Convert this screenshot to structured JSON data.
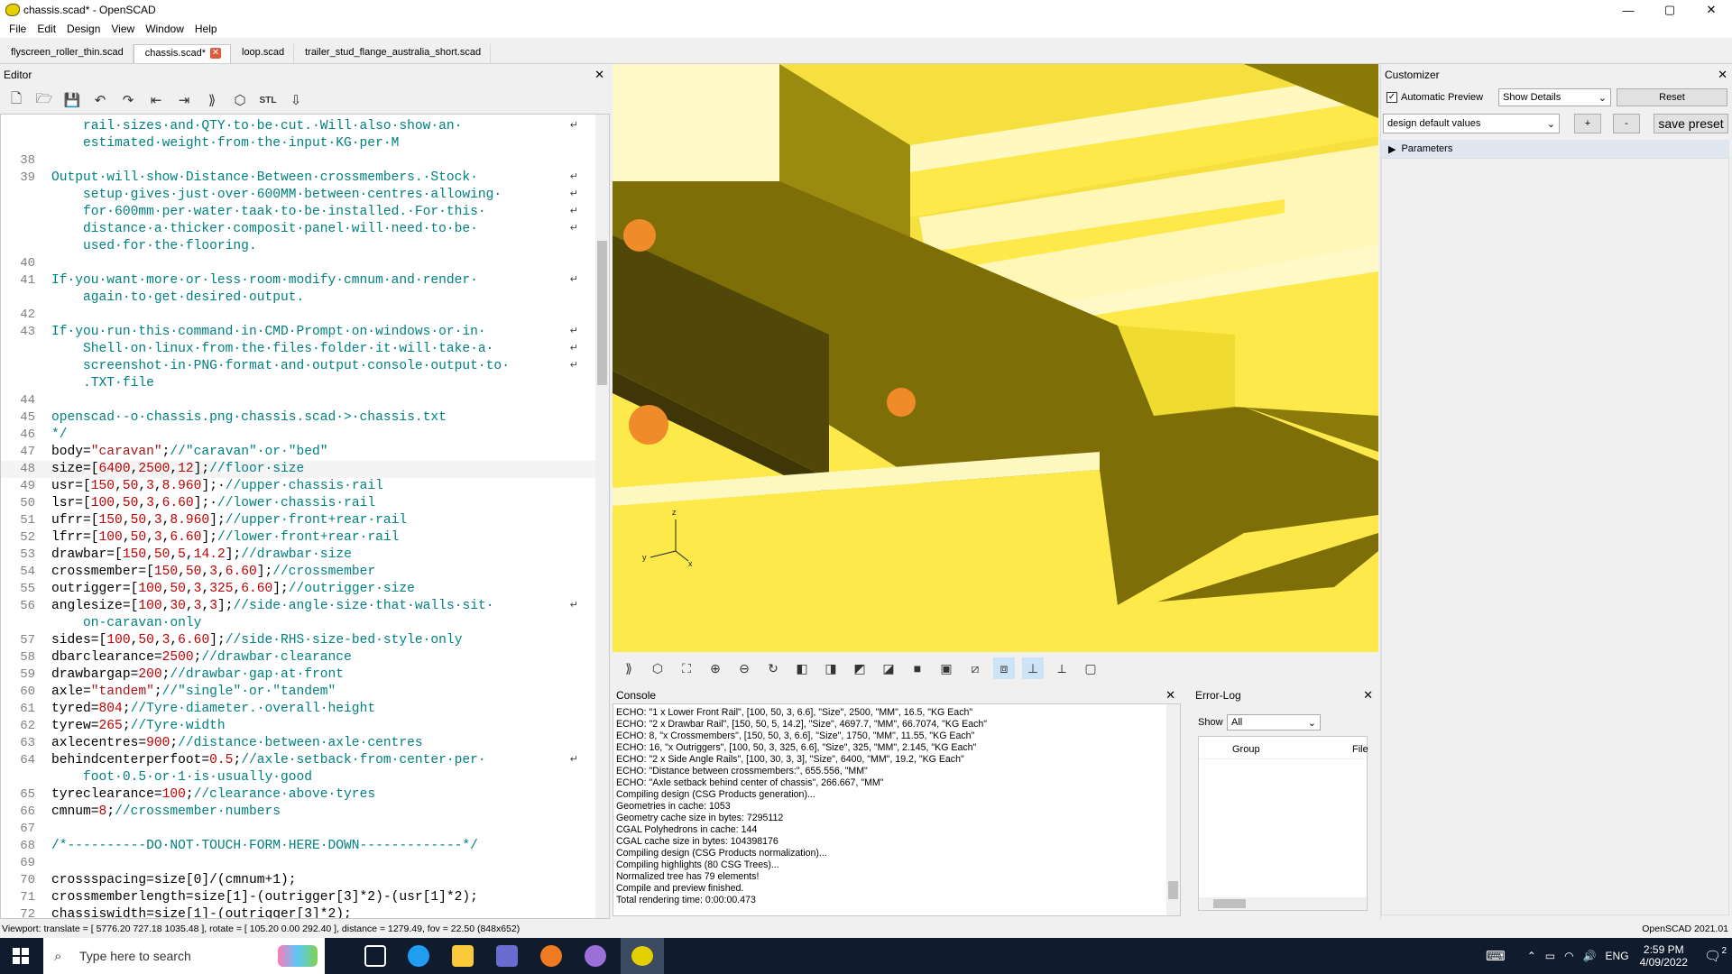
{
  "window": {
    "title": "chassis.scad* - OpenSCAD",
    "minimize": "—",
    "maximize": "▢",
    "close": "✕"
  },
  "menu": [
    "File",
    "Edit",
    "Design",
    "View",
    "Window",
    "Help"
  ],
  "tabs": [
    {
      "label": "flyscreen_roller_thin.scad"
    },
    {
      "label": "chassis.scad*"
    },
    {
      "label": "loop.scad"
    },
    {
      "label": "trailer_stud_flange_australia_short.scad"
    }
  ],
  "editor": {
    "title": "Editor",
    "close": "✕",
    "lines": [
      {
        "n": "",
        "t": "    rail·sizes·and·QTY·to·be·cut.·Will·also·show·an·",
        "c": "cm",
        "w": true
      },
      {
        "n": "",
        "t": "    estimated·weight·from·the·input·KG·per·M",
        "c": "cm",
        "w": false
      },
      {
        "n": "38",
        "t": "",
        "c": "cm",
        "w": false
      },
      {
        "n": "39",
        "t": "Output·will·show·Distance·Between·crossmembers.·Stock·",
        "c": "cm",
        "w": true
      },
      {
        "n": "",
        "t": "    setup·gives·just·over·600MM·between·centres·allowing·",
        "c": "cm",
        "w": true
      },
      {
        "n": "",
        "t": "    for·600mm·per·water·taak·to·be·installed.·For·this·",
        "c": "cm",
        "w": true
      },
      {
        "n": "",
        "t": "    distance·a·thicker·composit·panel·will·need·to·be·",
        "c": "cm",
        "w": true
      },
      {
        "n": "",
        "t": "    used·for·the·flooring.",
        "c": "cm",
        "w": false
      },
      {
        "n": "40",
        "t": "",
        "c": "cm",
        "w": false
      },
      {
        "n": "41",
        "t": "If·you·want·more·or·less·room·modify·cmnum·and·render·",
        "c": "cm",
        "w": true
      },
      {
        "n": "",
        "t": "    again·to·get·desired·output.",
        "c": "cm",
        "w": false
      },
      {
        "n": "42",
        "t": "",
        "c": "cm",
        "w": false
      },
      {
        "n": "43",
        "t": "If·you·run·this·command·in·CMD·Prompt·on·windows·or·in·",
        "c": "cm",
        "w": true
      },
      {
        "n": "",
        "t": "    Shell·on·linux·from·the·files·folder·it·will·take·a·",
        "c": "cm",
        "w": true
      },
      {
        "n": "",
        "t": "    screenshot·in·PNG·format·and·output·console·output·to·",
        "c": "cm",
        "w": true
      },
      {
        "n": "",
        "t": "    .TXT·file",
        "c": "cm",
        "w": false
      },
      {
        "n": "44",
        "t": "",
        "c": "cm",
        "w": false
      },
      {
        "n": "45",
        "t": "openscad·-o·chassis.png·chassis.scad·>·chassis.txt",
        "c": "cm",
        "w": false
      },
      {
        "n": "46",
        "t": "*/",
        "c": "cm",
        "w": false
      },
      {
        "n": "47",
        "t": "body=\"caravan\";//\"caravan\"·or·\"bed\"",
        "c": "mix",
        "w": false
      },
      {
        "n": "48",
        "t": "size=[6400,2500,12];//floor·size",
        "c": "mix",
        "w": false,
        "cur": true
      },
      {
        "n": "49",
        "t": "usr=[150,50,3,8.960];·//upper·chassis·rail",
        "c": "mix",
        "w": false
      },
      {
        "n": "50",
        "t": "lsr=[100,50,3,6.60];·//lower·chassis·rail",
        "c": "mix",
        "w": false
      },
      {
        "n": "51",
        "t": "ufrr=[150,50,3,8.960];//upper·front+rear·rail",
        "c": "mix",
        "w": false
      },
      {
        "n": "52",
        "t": "lfrr=[100,50,3,6.60];//lower·front+rear·rail",
        "c": "mix",
        "w": false
      },
      {
        "n": "53",
        "t": "drawbar=[150,50,5,14.2];//drawbar·size",
        "c": "mix",
        "w": false
      },
      {
        "n": "54",
        "t": "crossmember=[150,50,3,6.60];//crossmember",
        "c": "mix",
        "w": false
      },
      {
        "n": "55",
        "t": "outrigger=[100,50,3,325,6.60];//outrigger·size",
        "c": "mix",
        "w": false
      },
      {
        "n": "56",
        "t": "anglesize=[100,30,3,3];//side·angle·size·that·walls·sit·",
        "c": "mix",
        "w": true
      },
      {
        "n": "",
        "t": "    on-caravan·only",
        "c": "cm",
        "w": false
      },
      {
        "n": "57",
        "t": "sides=[100,50,3,6.60];//side·RHS·size-bed·style·only",
        "c": "mix",
        "w": false
      },
      {
        "n": "58",
        "t": "dbarclearance=2500;//drawbar·clearance",
        "c": "mix",
        "w": false
      },
      {
        "n": "59",
        "t": "drawbargap=200;//drawbar·gap·at·front",
        "c": "mix",
        "w": false
      },
      {
        "n": "60",
        "t": "axle=\"tandem\";//\"single\"·or·\"tandem\"",
        "c": "mix",
        "w": false
      },
      {
        "n": "61",
        "t": "tyred=804;//Tyre·diameter.·overall·height",
        "c": "mix",
        "w": false
      },
      {
        "n": "62",
        "t": "tyrew=265;//Tyre·width",
        "c": "mix",
        "w": false
      },
      {
        "n": "63",
        "t": "axlecentres=900;//distance·between·axle·centres",
        "c": "mix",
        "w": false
      },
      {
        "n": "64",
        "t": "behindcenterperfoot=0.5;//axle·setback·from·center·per·",
        "c": "mix",
        "w": true
      },
      {
        "n": "",
        "t": "    foot·0.5·or·1·is·usually·good",
        "c": "cm",
        "w": false
      },
      {
        "n": "65",
        "t": "tyreclearance=100;//clearance·above·tyres",
        "c": "mix",
        "w": false
      },
      {
        "n": "66",
        "t": "cmnum=8;//crossmember·numbers",
        "c": "mix",
        "w": false
      },
      {
        "n": "67",
        "t": "",
        "c": "cm",
        "w": false
      },
      {
        "n": "68",
        "t": "/*----------DO·NOT·TOUCH·FORM·HERE·DOWN-------------*/",
        "c": "cm",
        "w": false
      },
      {
        "n": "69",
        "t": "",
        "c": "cm",
        "w": false
      },
      {
        "n": "70",
        "t": "crossspacing=size[0]/(cmnum+1);",
        "c": "tx",
        "w": false
      },
      {
        "n": "71",
        "t": "crossmemberlength=size[1]-(outrigger[3]*2)-(usr[1]*2);",
        "c": "tx",
        "w": false
      },
      {
        "n": "72",
        "t": "chassiswidth=size[1]-(outrigger[3]*2);",
        "c": "tx",
        "w": false
      }
    ]
  },
  "console": {
    "title": "Console",
    "close": "✕",
    "lines": [
      "ECHO: \"1 x Lower Front Rail\", [100, 50, 3, 6.6], \"Size\", 2500, \"MM\", 16.5, \"KG Each\"",
      "ECHO: \"2 x Drawbar Rail\", [150, 50, 5, 14.2], \"Size\", 4697.7, \"MM\", 66.7074, \"KG Each\"",
      "ECHO: 8, \"x Crossmembers\", [150, 50, 3, 6.6], \"Size\", 1750, \"MM\", 11.55, \"KG Each\"",
      "ECHO: 16, \"x Outriggers\", [100, 50, 3, 325, 6.6], \"Size\", 325, \"MM\", 2.145, \"KG Each\"",
      "ECHO: \"2 x Side Angle Rails\", [100, 30, 3, 3], \"Size\", 6400, \"MM\", 19.2, \"KG Each\"",
      "ECHO: \"Distance between crossmembers:\", 655.556, \"MM\"",
      "ECHO: \"Axle setback behind center of chassis\", 266.667, \"MM\"",
      "Compiling design (CSG Products generation)...",
      "Geometries in cache: 1053",
      "Geometry cache size in bytes: 7295112",
      "CGAL Polyhedrons in cache: 144",
      "CGAL cache size in bytes: 104398176",
      "Compiling design (CSG Products normalization)...",
      "Compiling highlights (80 CSG Trees)...",
      "Normalized tree has 79 elements!",
      "Compile and preview finished.",
      "Total rendering time: 0:00:00.473"
    ]
  },
  "errorlog": {
    "title": "Error-Log",
    "close": "✕",
    "show_label": "Show",
    "show_value": "All",
    "col_group": "Group",
    "col_file": "File"
  },
  "customizer": {
    "title": "Customizer",
    "close": "✕",
    "auto_preview": "Automatic Preview",
    "show_details": "Show Details",
    "reset": "Reset",
    "preset": "design default values",
    "plus": "+",
    "minus": "-",
    "save_preset": "save preset",
    "parameters": "Parameters"
  },
  "status": {
    "viewport": "Viewport: translate = [ 5776.20 727.18 1035.48 ], rotate = [ 105.20 0.00 292.40 ], distance = 1279.49, fov = 22.50 (848x652)",
    "version": "OpenSCAD 2021.01"
  },
  "taskbar": {
    "search_placeholder": "Type here to search",
    "lang": "ENG",
    "time": "2:59 PM",
    "date": "4/09/2022",
    "notif_count": "2"
  },
  "axes": {
    "z": "z",
    "y": "y",
    "x": "x"
  }
}
